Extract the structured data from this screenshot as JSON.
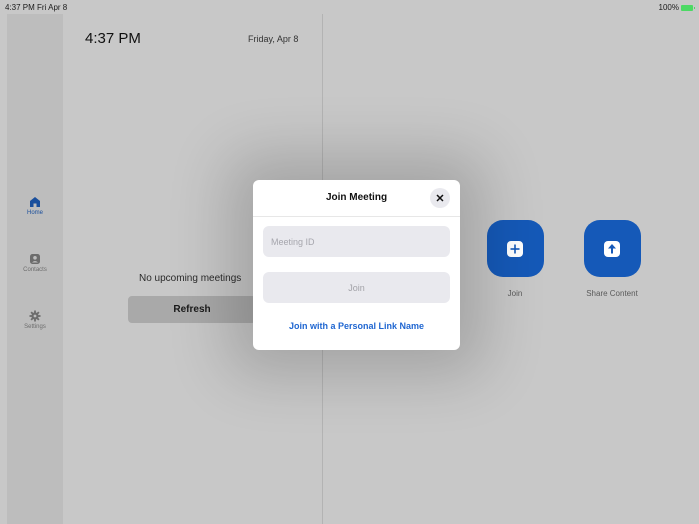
{
  "status_bar": {
    "time": "4:37 PM  Fri Apr 8",
    "battery": "100%"
  },
  "sidebar": {
    "items": [
      {
        "label": "Home",
        "icon": "home-icon",
        "active": true
      },
      {
        "label": "Contacts",
        "icon": "contacts-icon",
        "active": false
      },
      {
        "label": "Settings",
        "icon": "gear-icon",
        "active": false
      }
    ]
  },
  "left_panel": {
    "time": "4:37 PM",
    "date": "Friday, Apr 8",
    "empty_text": "No upcoming meetings",
    "refresh_label": "Refresh"
  },
  "actions": {
    "join_label": "Join",
    "share_label": "Share Content"
  },
  "modal": {
    "title": "Join Meeting",
    "meeting_id_placeholder": "Meeting ID",
    "join_label": "Join",
    "personal_link_label": "Join with a Personal Link Name"
  },
  "colors": {
    "accent": "#1559b8",
    "link": "#1f66d1",
    "battery": "#4cd964"
  }
}
